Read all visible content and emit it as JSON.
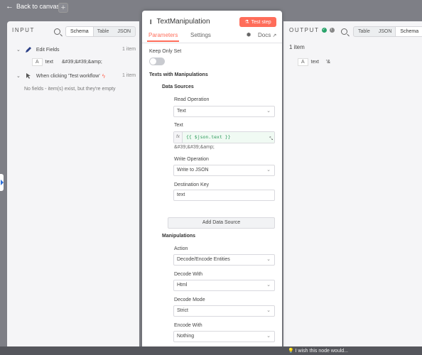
{
  "topbar": {
    "back_label": "Back to canvas",
    "add_symbol": "+"
  },
  "input_pane": {
    "header": "INPUT",
    "view_tabs": [
      "Schema",
      "Table",
      "JSON"
    ],
    "active_view": "Schema",
    "nodes": [
      {
        "name": "Edit Fields",
        "count": "1 item",
        "field_type": "A",
        "field_name": "text",
        "field_value": "&#39;&#39;&amp;"
      },
      {
        "name": "When clicking 'Test workflow'",
        "count": "1 item",
        "empty_message": "No fields - item(s) exist, but they're empty"
      }
    ]
  },
  "modal": {
    "title": "TextManipulation",
    "test_step_label": "Test step",
    "tabs": [
      "Parameters",
      "Settings"
    ],
    "active_tab": "Parameters",
    "docs_label": "Docs",
    "keep_only_set_label": "Keep Only Set",
    "keep_only_set": false,
    "texts_section": "Texts with Manipulations",
    "data_sources_section": "Data Sources",
    "read_operation_label": "Read Operation",
    "read_operation_value": "Text",
    "text_label": "Text",
    "fx_label": "fx",
    "text_expression": "{{ $json.text }}",
    "text_preview": "&#39;&#39;&amp;",
    "write_operation_label": "Write Operation",
    "write_operation_value": "Write to JSON",
    "destination_key_label": "Destination Key",
    "destination_key_value": "text",
    "add_data_source_label": "Add Data Source",
    "manipulations_section": "Manipulations",
    "action_label": "Action",
    "action_value": "Decode/Encode Entities",
    "decode_with_label": "Decode With",
    "decode_with_value": "Html",
    "decode_mode_label": "Decode Mode",
    "decode_mode_value": "Strict",
    "encode_with_label": "Encode With",
    "encode_with_value": "Nothing"
  },
  "output_pane": {
    "header": "OUTPUT",
    "view_tabs": [
      "Table",
      "JSON",
      "Schema"
    ],
    "active_view": "Schema",
    "count": "1 item",
    "field_type": "A",
    "field_name": "text",
    "field_value": "'&"
  },
  "footer": {
    "feedback_label": "I wish this node would..."
  },
  "colors": {
    "accent": "#ff6d5a",
    "success": "#29a36a",
    "canvas": "#7e7f86",
    "expression": "#2d9a5b"
  }
}
